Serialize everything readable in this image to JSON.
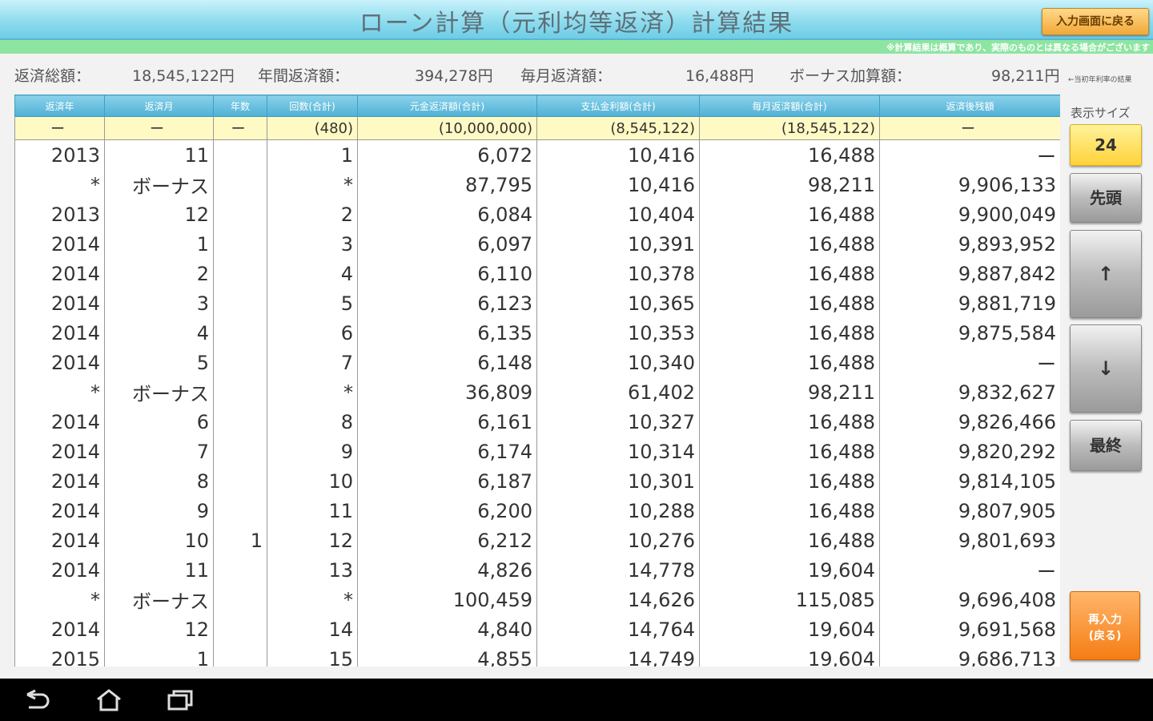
{
  "header": {
    "title": "ローン計算（元利均等返済）計算結果",
    "back_button": "入力画面に戻る",
    "notice": "※計算結果は概算であり、実際のものとは異なる場合がございます"
  },
  "summary": {
    "total_label": "返済総額：",
    "total_value": "18,545,122円",
    "annual_label": "年間返済額：",
    "annual_value": "394,278円",
    "monthly_label": "毎月返済額：",
    "monthly_value": "16,488円",
    "bonus_label": "ボーナス加算額：",
    "bonus_value": "98,211円",
    "note": "←当初年利率の結果"
  },
  "table": {
    "headers": [
      "返済年",
      "返済月",
      "年数",
      "回数(合計)",
      "元金返済額(合計)",
      "支払金利額(合計)",
      "毎月返済額(合計)",
      "返済後残額"
    ],
    "totals": [
      "ー",
      "ー",
      "ー",
      "(480)",
      "(10,000,000)",
      "(8,545,122)",
      "(18,545,122)",
      "ー"
    ],
    "rows": [
      [
        "2013",
        "11",
        "",
        "1",
        "6,072",
        "10,416",
        "16,488",
        "ー"
      ],
      [
        "*",
        "ボーナス",
        "",
        "*",
        "87,795",
        "10,416",
        "98,211",
        "9,906,133"
      ],
      [
        "2013",
        "12",
        "",
        "2",
        "6,084",
        "10,404",
        "16,488",
        "9,900,049"
      ],
      [
        "2014",
        "1",
        "",
        "3",
        "6,097",
        "10,391",
        "16,488",
        "9,893,952"
      ],
      [
        "2014",
        "2",
        "",
        "4",
        "6,110",
        "10,378",
        "16,488",
        "9,887,842"
      ],
      [
        "2014",
        "3",
        "",
        "5",
        "6,123",
        "10,365",
        "16,488",
        "9,881,719"
      ],
      [
        "2014",
        "4",
        "",
        "6",
        "6,135",
        "10,353",
        "16,488",
        "9,875,584"
      ],
      [
        "2014",
        "5",
        "",
        "7",
        "6,148",
        "10,340",
        "16,488",
        "ー"
      ],
      [
        "*",
        "ボーナス",
        "",
        "*",
        "36,809",
        "61,402",
        "98,211",
        "9,832,627"
      ],
      [
        "2014",
        "6",
        "",
        "8",
        "6,161",
        "10,327",
        "16,488",
        "9,826,466"
      ],
      [
        "2014",
        "7",
        "",
        "9",
        "6,174",
        "10,314",
        "16,488",
        "9,820,292"
      ],
      [
        "2014",
        "8",
        "",
        "10",
        "6,187",
        "10,301",
        "16,488",
        "9,814,105"
      ],
      [
        "2014",
        "9",
        "",
        "11",
        "6,200",
        "10,288",
        "16,488",
        "9,807,905"
      ],
      [
        "2014",
        "10",
        "1",
        "12",
        "6,212",
        "10,276",
        "16,488",
        "9,801,693"
      ],
      [
        "2014",
        "11",
        "",
        "13",
        "4,826",
        "14,778",
        "19,604",
        "ー"
      ],
      [
        "*",
        "ボーナス",
        "",
        "*",
        "100,459",
        "14,626",
        "115,085",
        "9,696,408"
      ],
      [
        "2014",
        "12",
        "",
        "14",
        "4,840",
        "14,764",
        "19,604",
        "9,691,568"
      ],
      [
        "2015",
        "1",
        "",
        "15",
        "4,855",
        "14,749",
        "19,604",
        "9,686,713"
      ]
    ]
  },
  "panel": {
    "display_size_label": "表示サイズ",
    "display_size_value": "24",
    "first_button": "先頭",
    "up_button": "↑",
    "down_button": "↓",
    "last_button": "最終",
    "reenter_button_line1": "再入力",
    "reenter_button_line2": "(戻る)"
  }
}
